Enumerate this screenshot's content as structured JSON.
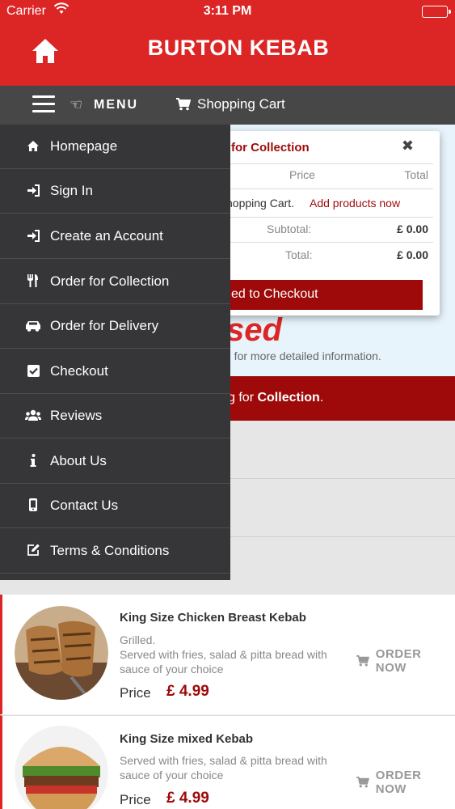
{
  "status_bar": {
    "carrier": "Carrier",
    "time": "3:11 PM"
  },
  "header": {
    "title": "BURTON KEBAB",
    "home_icon": "home-icon"
  },
  "nav": {
    "menu_label": "MENU",
    "cart_label": "Shopping Cart"
  },
  "drawer": {
    "items": [
      {
        "label": "Homepage",
        "icon": "home-icon"
      },
      {
        "label": "Sign In",
        "icon": "sign-in-icon"
      },
      {
        "label": "Create an Account",
        "icon": "sign-in-icon"
      },
      {
        "label": "Order for Collection",
        "icon": "cutlery-icon"
      },
      {
        "label": "Order for Delivery",
        "icon": "car-icon"
      },
      {
        "label": "Checkout",
        "icon": "check-square-icon"
      },
      {
        "label": "Reviews",
        "icon": "users-icon"
      },
      {
        "label": "About Us",
        "icon": "info-icon"
      },
      {
        "label": "Contact Us",
        "icon": "mobile-icon"
      },
      {
        "label": "Terms & Conditions",
        "icon": "edit-icon"
      }
    ]
  },
  "cart_popup": {
    "title": "for Collection",
    "price_header": "Price",
    "total_header": "Total",
    "empty_text": "hopping Cart.",
    "add_link": "Add products now",
    "subtotal_label": "Subtotal:",
    "subtotal_value": "£ 0.00",
    "total_label": "Total:",
    "total_value": "£ 0.00",
    "checkout_label": "ed to Checkout"
  },
  "background": {
    "closed_text": "sed",
    "info_link": "e",
    "info_text": " for more detailed information.",
    "collect_prefix": "g for ",
    "collect_bold": "Collection",
    "collect_suffix": "."
  },
  "products": [
    {
      "name": "King Size Chicken Breast Kebab",
      "desc_line1": "Grilled.",
      "desc_line2": "Served with fries, salad & pitta bread with sauce of your choice",
      "price_label": "Price",
      "price": "£ 4.99",
      "order_label": "ORDER NOW"
    },
    {
      "name": "King Size mixed Kebab",
      "desc_line1": "",
      "desc_line2": "Served with fries, salad & pitta bread with sauce of your choice",
      "price_label": "Price",
      "price": "£ 4.99",
      "order_label": "ORDER NOW"
    }
  ],
  "colors": {
    "brand_red": "#dc2626",
    "dark_red": "#9e0a0a",
    "nav_gray": "#474747",
    "drawer_bg": "#363538"
  }
}
